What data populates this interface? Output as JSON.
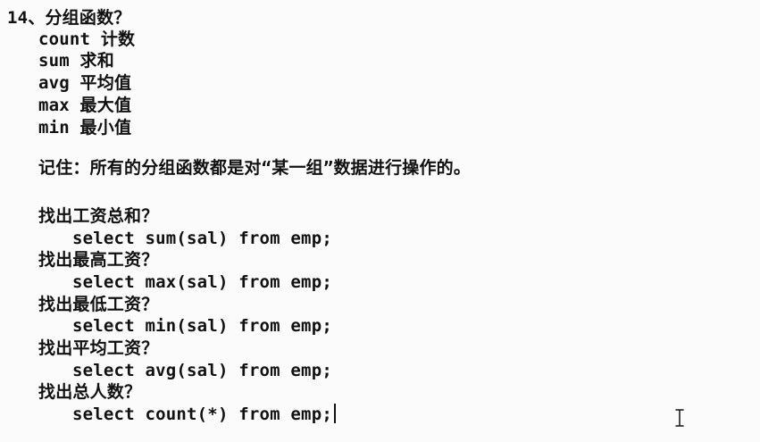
{
  "heading": "14、分组函数？",
  "functions": [
    "count 计数",
    "sum 求和",
    "avg 平均值",
    "max 最大值",
    "min 最小值"
  ],
  "note": "记住：所有的分组函数都是对“某一组”数据进行操作的。",
  "examples": [
    {
      "question": "找出工资总和？",
      "sql": "select sum(sal) from emp;"
    },
    {
      "question": "找出最高工资？",
      "sql": "select max(sal) from emp;"
    },
    {
      "question": "找出最低工资？",
      "sql": "select min(sal) from emp;"
    },
    {
      "question": "找出平均工资？",
      "sql": "select avg(sal) from emp;"
    },
    {
      "question": "找出总人数？",
      "sql": "select count(*) from emp;"
    }
  ],
  "icons": {
    "text_cursor": "i-beam-cursor-icon"
  }
}
